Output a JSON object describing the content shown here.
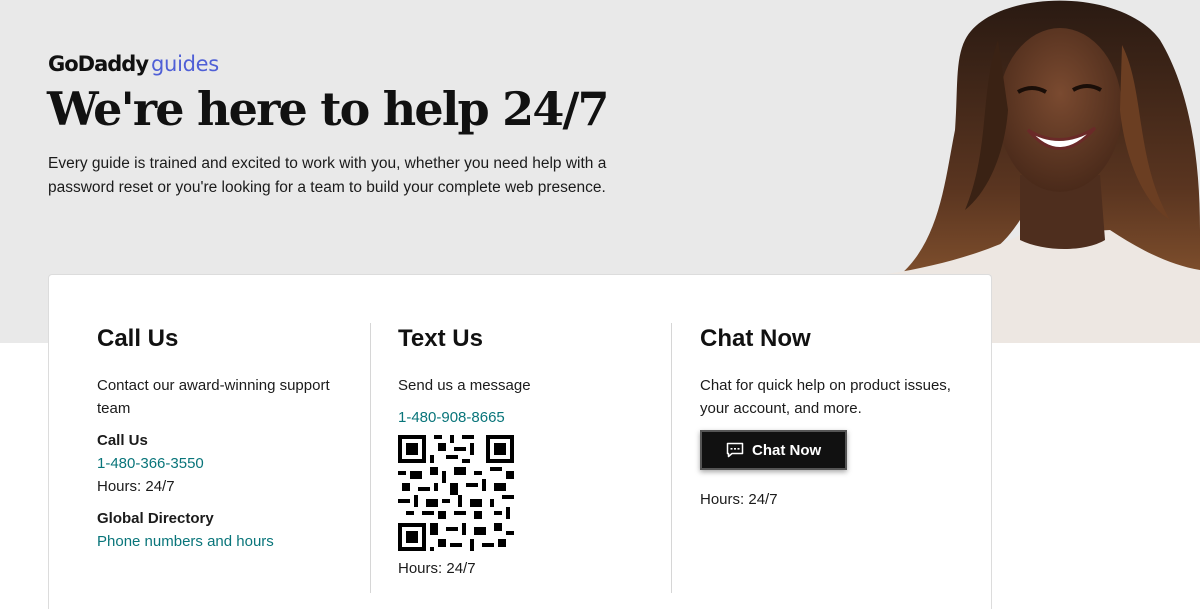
{
  "brand": {
    "name": "GoDaddy",
    "sub": "guides"
  },
  "hero": {
    "title": "We're here to help 24/7",
    "intro": "Every guide is trained and excited to work with you, whether you need help with a password reset or you're looking for a team to build your complete web presence."
  },
  "call": {
    "title": "Call Us",
    "description": "Contact our award-winning support team",
    "phone_label": "Call Us",
    "phone": "1-480-366-3550",
    "hours": "Hours: 24/7",
    "directory_label": "Global Directory",
    "directory_link": "Phone numbers and hours"
  },
  "text": {
    "title": "Text Us",
    "description": "Send us a message",
    "phone": "1-480-908-8665",
    "hours": "Hours: 24/7"
  },
  "chat": {
    "title": "Chat Now",
    "description": "Chat for quick help on product issues, your account, and more.",
    "button_label": "Chat Now",
    "hours": "Hours: 24/7"
  },
  "colors": {
    "link": "#09757a",
    "brand_accent": "#4f5fd6",
    "hero_bg": "#e9e9e9",
    "button_bg": "#111111"
  },
  "icons": [
    "chat-bubble-icon",
    "qr-code"
  ]
}
